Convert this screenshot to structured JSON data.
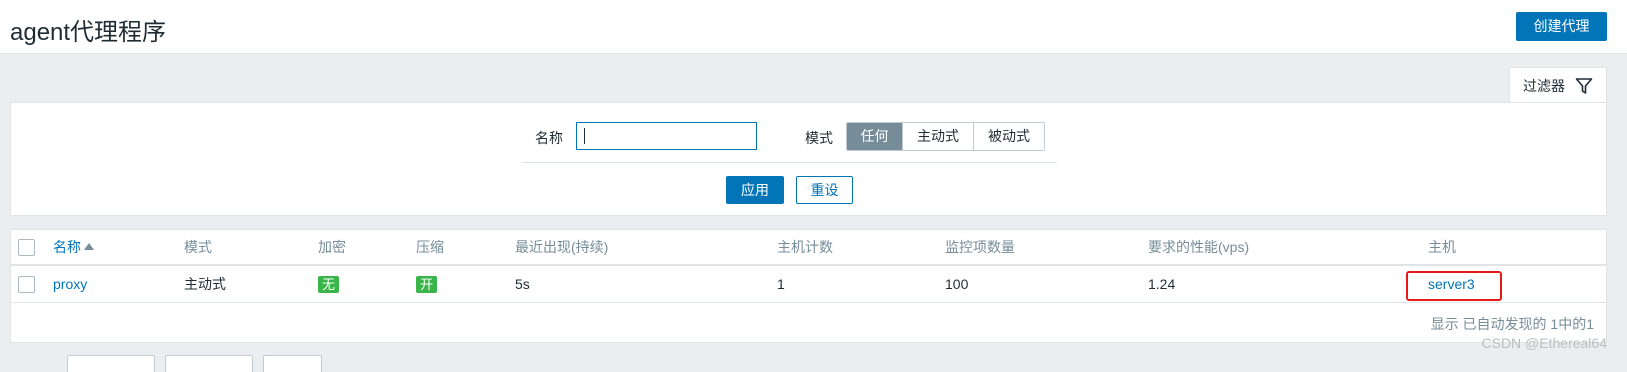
{
  "header": {
    "title": "agent代理程序",
    "create_button": "创建代理"
  },
  "filter": {
    "tab_label": "过滤器",
    "name_label": "名称",
    "name_value": "",
    "mode_label": "模式",
    "mode_options": [
      "任何",
      "主动式",
      "被动式"
    ],
    "mode_selected": "任何",
    "apply_button": "应用",
    "reset_button": "重设"
  },
  "table": {
    "columns": [
      "名称",
      "模式",
      "加密",
      "压缩",
      "最近出现(持续)",
      "主机计数",
      "监控项数量",
      "要求的性能(vps)",
      "主机"
    ],
    "sort_column": "名称",
    "sort_direction": "ascending",
    "rows": [
      {
        "name": "proxy",
        "mode": "主动式",
        "encryption": "无",
        "compression": "开",
        "last_seen": "5s",
        "host_count": "1",
        "item_count": "100",
        "required_performance": "1.24",
        "hosts": "server3"
      }
    ],
    "footer": "显示 已自动发现的 1中的1"
  },
  "watermark": "CSDN @Ethereal64",
  "colors": {
    "primary": "#0275b8",
    "badge_green": "#3ab54a",
    "segment_active": "#768d99",
    "highlight_red": "#e31b1b"
  },
  "icons": {
    "filter": "funnel-icon",
    "sort": "sort-ascending-icon"
  }
}
